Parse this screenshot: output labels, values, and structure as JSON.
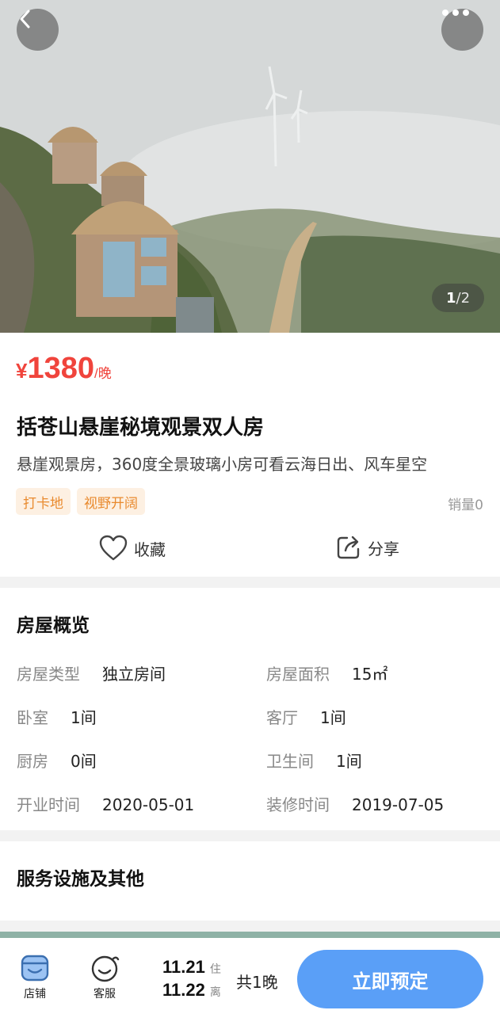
{
  "gallery": {
    "current": "1",
    "total": "/2"
  },
  "product": {
    "currency": "¥",
    "price": "1380",
    "unit": "/晚",
    "title": "括苍山悬崖秘境观景双人房",
    "subtitle": "悬崖观景房，360度全景玻璃小房可看云海日出、风车星空",
    "tags": [
      "打卡地",
      "视野开阔"
    ],
    "sales": "销量0"
  },
  "actions": {
    "favorite": "收藏",
    "share": "分享"
  },
  "overview": {
    "title": "房屋概览",
    "items": [
      {
        "key": "房屋类型",
        "value": "独立房间"
      },
      {
        "key": "房屋面积",
        "value": "15㎡"
      },
      {
        "key": "卧室",
        "value": "1间"
      },
      {
        "key": "客厅",
        "value": "1间"
      },
      {
        "key": "厨房",
        "value": "0间"
      },
      {
        "key": "卫生间",
        "value": "1间"
      },
      {
        "key": "开业时间",
        "value": "2020-05-01"
      },
      {
        "key": "装修时间",
        "value": "2019-07-05"
      }
    ]
  },
  "services": {
    "title": "服务设施及其他"
  },
  "bottom": {
    "shop": "店铺",
    "service": "客服",
    "checkin_date": "11.21",
    "checkin_label": "住",
    "checkout_date": "11.22",
    "checkout_label": "离",
    "nights": "共1晚",
    "book": "立即预定"
  },
  "colors": {
    "price": "#f0443c",
    "tag_bg": "#fdf0e2",
    "tag_text": "#e98a2e",
    "primary_button": "#5a9ff7"
  },
  "icons": [
    "back-icon",
    "more-icon",
    "heart-icon",
    "share-icon",
    "shop-icon",
    "customer-service-icon"
  ]
}
